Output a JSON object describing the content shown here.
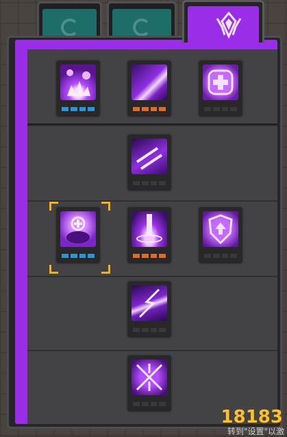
{
  "tabs": [
    {
      "icon": "swirl-icon",
      "active": false
    },
    {
      "icon": "swirl-icon",
      "active": false
    },
    {
      "icon": "purple-crest-icon",
      "active": true
    }
  ],
  "colors": {
    "panel_accent": "#9a2ee8",
    "level_blue": "#2b95d6",
    "level_orange": "#e06a2a",
    "selection": "#f0b21c"
  },
  "skill_tree": {
    "rows": [
      {
        "slots": [
          {
            "icon": "purple-burst-icon",
            "level_color": "blue",
            "selected": false
          },
          {
            "icon": "purple-slash-icon",
            "level_color": "orange",
            "selected": false
          },
          {
            "icon": "heal-cross-icon",
            "level_color": "gray",
            "selected": false
          }
        ]
      },
      {
        "slots": [
          {
            "icon": "twin-swords-icon",
            "level_color": "gray",
            "selected": false
          }
        ]
      },
      {
        "slots": [
          {
            "icon": "pet-shield-icon",
            "level_color": "blue",
            "selected": true
          },
          {
            "icon": "sword-pillar-icon",
            "level_color": "orange",
            "selected": false
          },
          {
            "icon": "armor-up-shield-icon",
            "level_color": "gray",
            "selected": false
          }
        ]
      },
      {
        "slots": [
          {
            "icon": "lightning-slash-icon",
            "level_color": "gray",
            "selected": false
          }
        ]
      },
      {
        "slots": [
          {
            "icon": "crossed-blades-icon",
            "level_color": "gray",
            "selected": false
          }
        ]
      }
    ]
  },
  "watermark": {
    "logo": "18183",
    "sub": "转到\"设置\"以激"
  }
}
